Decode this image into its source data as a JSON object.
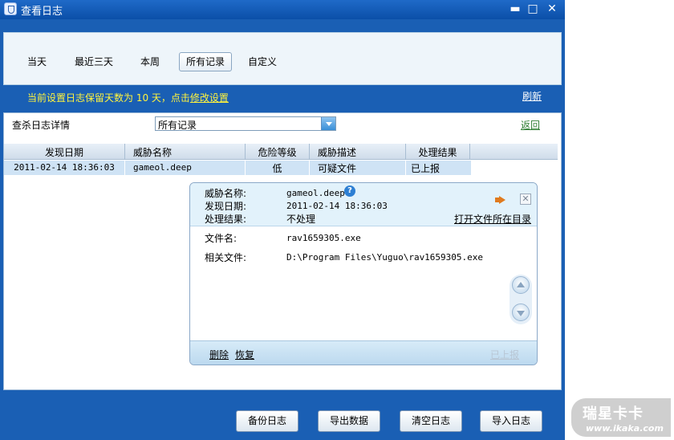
{
  "window": {
    "title": "查看日志"
  },
  "tabs": [
    {
      "label": "当天"
    },
    {
      "label": "最近三天"
    },
    {
      "label": "本周"
    },
    {
      "label": "所有记录",
      "active": true
    },
    {
      "label": "自定义"
    }
  ],
  "notice": {
    "text": "当前设置日志保留天数为 10 天，点击",
    "link": "修改设置"
  },
  "refresh_label": "刷新",
  "detail": {
    "label": "查杀日志详情",
    "select_value": "所有记录",
    "back_label": "返回"
  },
  "table": {
    "columns": [
      "发现日期",
      "威胁名称",
      "危险等级",
      "威胁描述",
      "处理结果"
    ],
    "rows": [
      {
        "date": "2011-02-14 18:36:03",
        "name": "gameol.deep",
        "level": "低",
        "desc": "可疑文件",
        "result": "已上报"
      }
    ]
  },
  "popup": {
    "threat_name_label": "威胁名称:",
    "threat_name": "gameol.deep",
    "found_date_label": "发现日期:",
    "found_date": "2011-02-14 18:36:03",
    "result_label": "处理结果:",
    "result": "不处理",
    "open_dir_label": "打开文件所在目录",
    "file_name_label": "文件名:",
    "file_name": "rav1659305.exe",
    "related_file_label": "相关文件:",
    "related_file": "D:\\Program Files\\Yuguo\\rav1659305.exe",
    "delete_label": "删除",
    "restore_label": "恢复",
    "reported_label": "已上报"
  },
  "buttons": {
    "backup": "备份日志",
    "export": "导出数据",
    "clear": "清空日志",
    "import": "导入日志"
  },
  "watermark": {
    "logo": "瑞星卡卡",
    "url": "www.ikaka.com"
  },
  "colors": {
    "window_blue": "#1a5fb4",
    "notice_yellow": "#fff33d",
    "back_green": "#2e7d32"
  }
}
